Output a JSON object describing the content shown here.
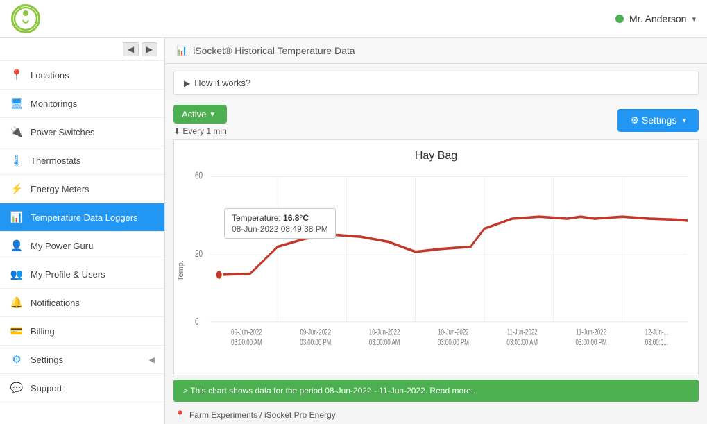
{
  "app": {
    "logo_text": "iSocket"
  },
  "user": {
    "status_color": "#4caf50",
    "name": "Mr. Anderson",
    "chevron": "▾"
  },
  "sidebar": {
    "nav_arrows_label": "◀ ▶",
    "items": [
      {
        "id": "locations",
        "label": "Locations",
        "icon": "📍",
        "active": false
      },
      {
        "id": "monitorings",
        "label": "Monitorings",
        "icon": "🖥",
        "active": false
      },
      {
        "id": "power-switches",
        "label": "Power Switches",
        "icon": "🔌",
        "active": false
      },
      {
        "id": "thermostats",
        "label": "Thermostats",
        "icon": "🌡",
        "active": false
      },
      {
        "id": "energy-meters",
        "label": "Energy Meters",
        "icon": "⚡",
        "active": false
      },
      {
        "id": "temperature-data-loggers",
        "label": "Temperature Data Loggers",
        "icon": "📊",
        "active": true
      },
      {
        "id": "my-power-guru",
        "label": "My Power Guru",
        "icon": "👤",
        "active": false
      },
      {
        "id": "my-profile-users",
        "label": "My Profile & Users",
        "icon": "👥",
        "active": false
      },
      {
        "id": "notifications",
        "label": "Notifications",
        "icon": "🔔",
        "active": false
      },
      {
        "id": "billing",
        "label": "Billing",
        "icon": "💳",
        "active": false
      },
      {
        "id": "settings",
        "label": "Settings",
        "icon": "⚙",
        "active": false,
        "has_chevron": true
      },
      {
        "id": "support",
        "label": "Support",
        "icon": "💬",
        "active": false
      }
    ]
  },
  "content": {
    "header_icon": "📊",
    "header_title": "iSocket® Historical Temperature Data",
    "how_it_works": "How it works?",
    "active_label": "Active",
    "active_chevron": "▾",
    "every_label": "⬇ Every 1 min",
    "settings_label": "⚙ Settings",
    "settings_chevron": "▾",
    "chart_title": "Hay Bag",
    "y_label": "Temp.",
    "y_values": [
      "60",
      "20",
      "0"
    ],
    "x_values": [
      "09-Jun-2022\n03:00:00 AM",
      "09-Jun-2022\n03:00:00 PM",
      "10-Jun-2022\n03:00:00 AM",
      "10-Jun-2022\n03:00:00 PM",
      "11-Jun-2022\n03:00:00 AM",
      "11-Jun-2022\n03:00:00 PM",
      "12-Jun-..."
    ],
    "tooltip": {
      "temp_label": "Temperature: ",
      "temp_value": "16.8°C",
      "date_value": "08-Jun-2022 08:49:38 PM"
    },
    "info_bar": "> This chart shows data for the period 08-Jun-2022 - 11-Jun-2022. Read more...",
    "footer_icon": "📍",
    "footer_location": "Farm Experiments / iSocket Pro Energy"
  }
}
